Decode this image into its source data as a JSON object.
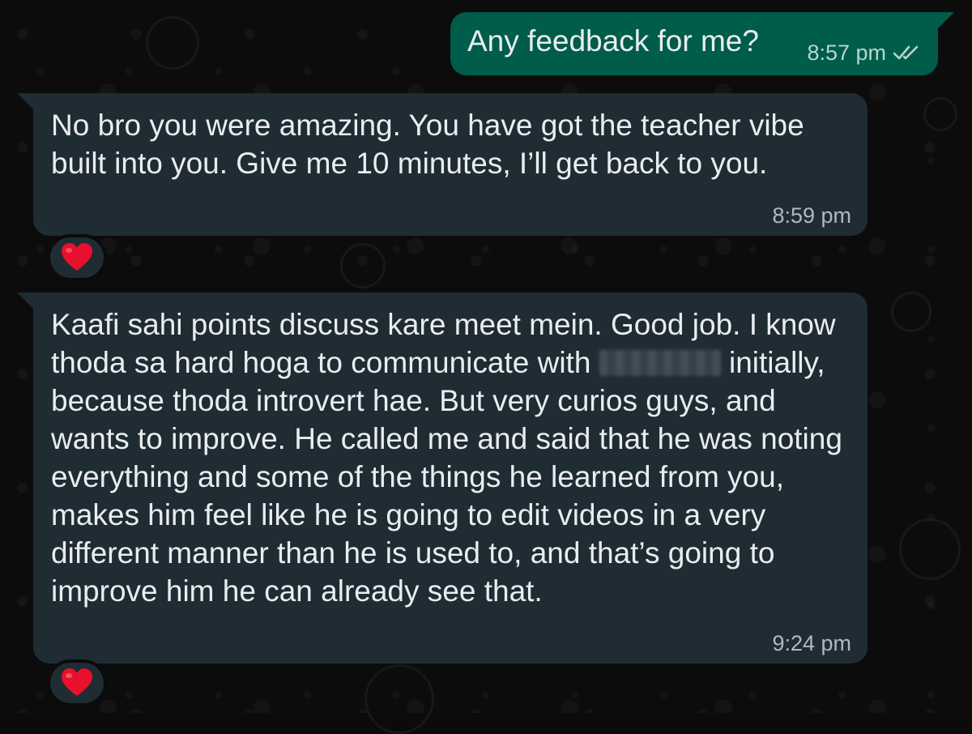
{
  "messages": [
    {
      "direction": "outgoing",
      "text": "Any feedback for me?",
      "time": "8:57 pm",
      "status_icon": "double-check-icon"
    },
    {
      "direction": "incoming",
      "text": "No bro you were amazing. You have got the teacher vibe built into you. Give me 10 minutes, I’ll get back to you.",
      "time": "8:59 pm",
      "reaction": "❤️"
    },
    {
      "direction": "incoming",
      "text_before": "Kaafi sahi points discuss kare meet mein. Good job. I know thoda sa hard hoga to communicate with ",
      "text_after": " initially, because thoda introvert hae. But very curios guys, and wants to improve. He called me and said that he was noting everything and some of the things he learned from you, makes him feel like he is going to edit videos in a very different manner than he is used to, and that’s going to improve him he can already see that.",
      "time": "9:24 pm",
      "reaction": "❤️",
      "redacted_name": true
    }
  ],
  "colors": {
    "outgoing_bubble": "#005c4b",
    "incoming_bubble": "#1f2c33",
    "background": "#0b0b0b",
    "text": "#e9edef",
    "meta": "#aebac1"
  }
}
